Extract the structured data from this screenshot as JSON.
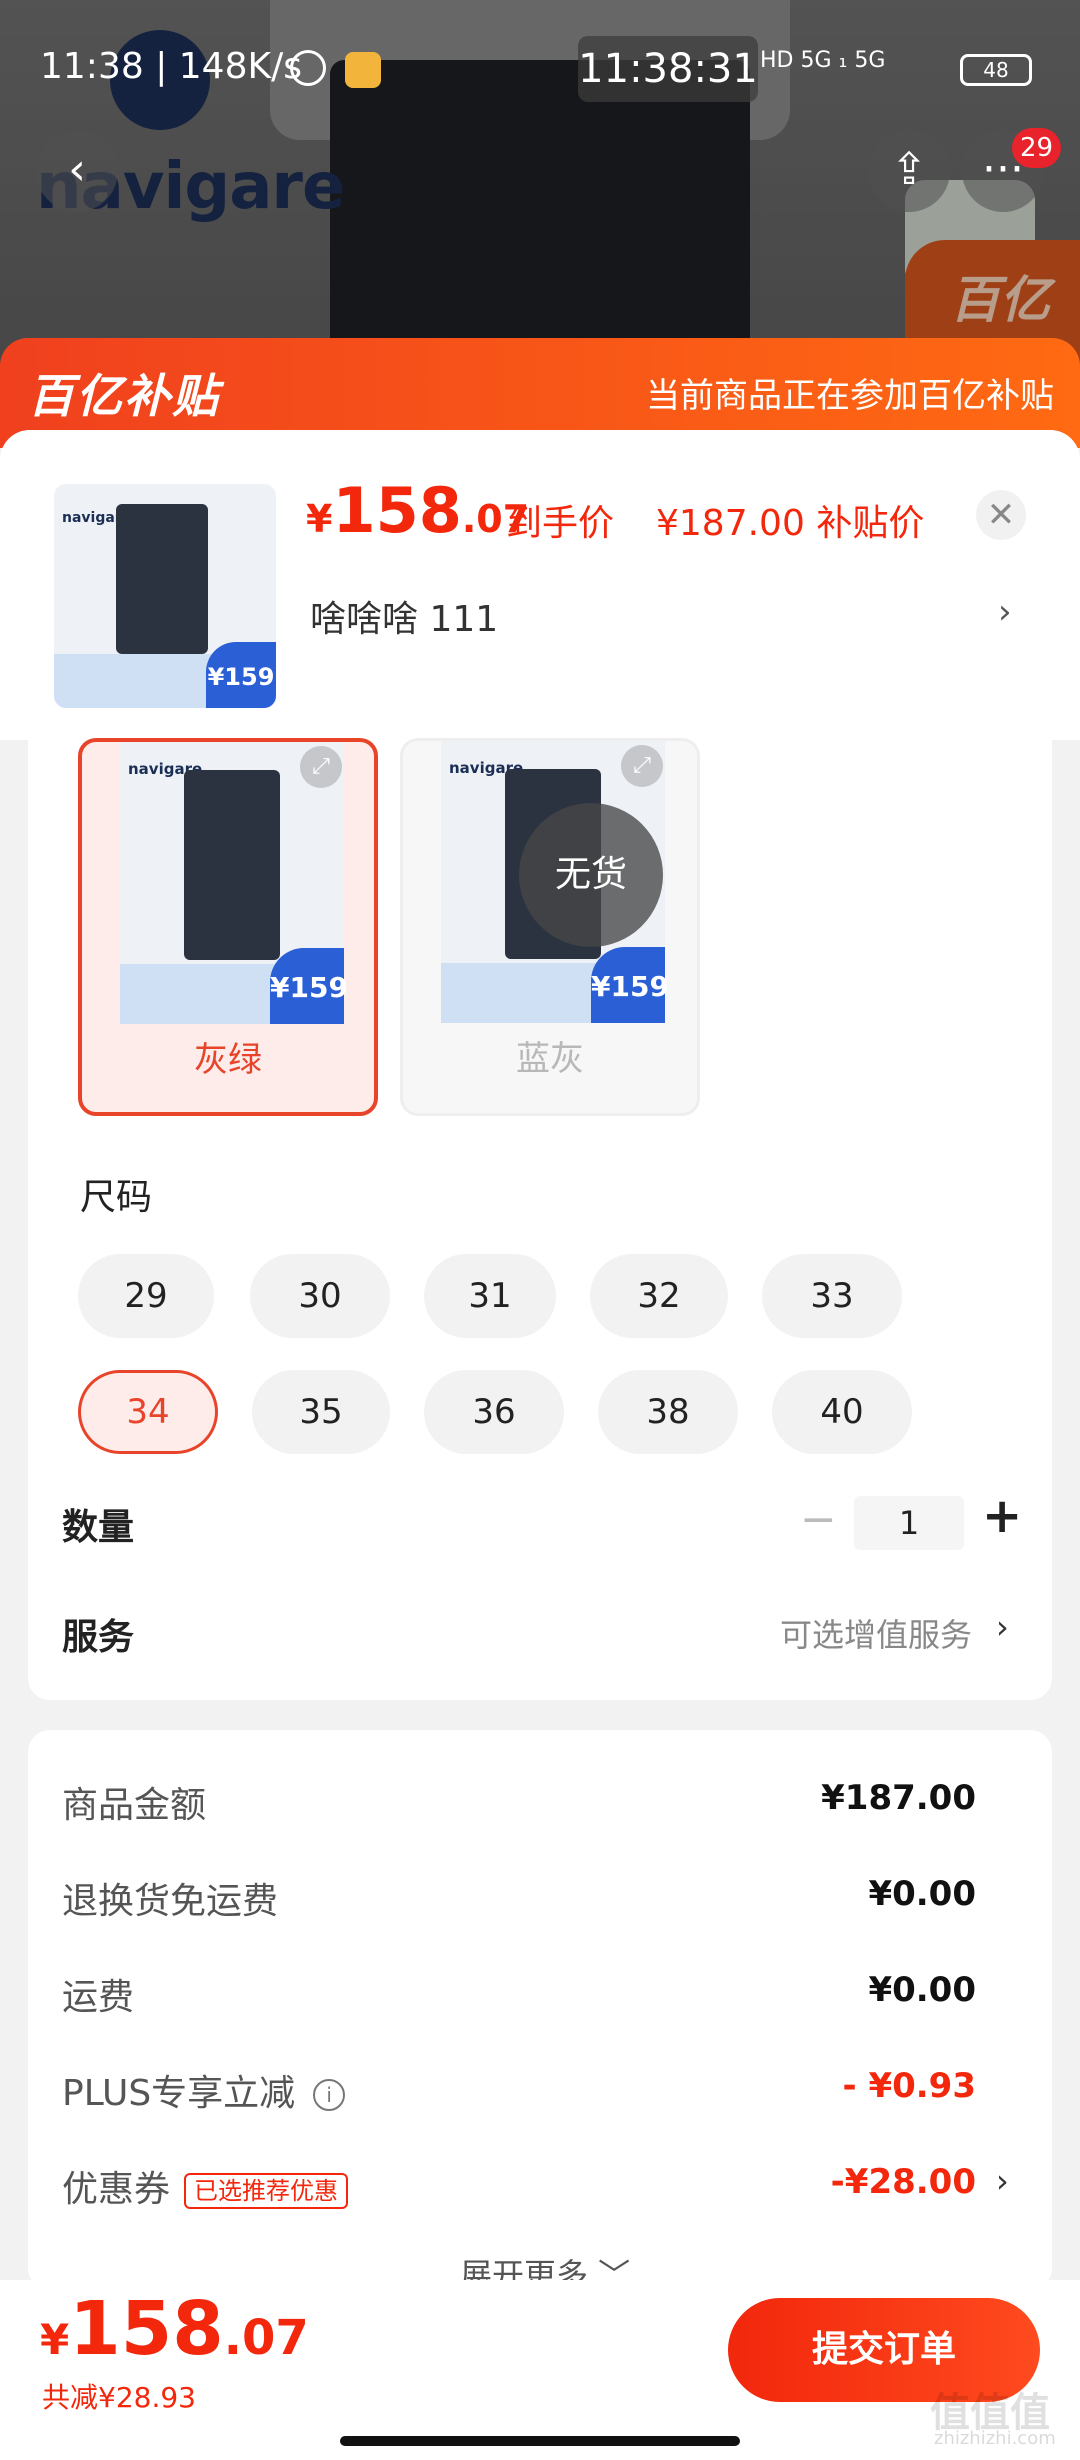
{
  "status_bar": {
    "time_left": "11:38 | 148K/s",
    "clock_overlay": "11:38:31",
    "network": "HD 5G ₁ 5G",
    "battery": "48"
  },
  "background": {
    "brand": "navigare",
    "badge_text": "百亿补"
  },
  "nav": {
    "back_icon": "‹",
    "share_icon": "⇪",
    "more_icon": "···",
    "message_count": "29"
  },
  "subsidy_bar": {
    "logo": "百亿补贴",
    "tip": "当前商品正在参加百亿补贴"
  },
  "sku_header": {
    "thumb_brand": "navigare",
    "thumb_price": "¥159",
    "price_yen": "¥",
    "price_int": "158",
    "price_dec": ".07",
    "price_label": "到手价",
    "subsidy_price": "¥187.00 补贴价",
    "close_icon": "✕",
    "selected_spec": "啥啥啥  111",
    "arrow": "›"
  },
  "colors": {
    "options": [
      {
        "label": "灰绿",
        "thumb_price": "¥159",
        "brand": "navigare",
        "selected": true
      },
      {
        "label": "蓝灰",
        "thumb_price": "¥159",
        "brand": "navigare",
        "soldout_text": "无货",
        "selected": false
      }
    ],
    "expand_icon": "⤢"
  },
  "sizes": {
    "title": "尺码",
    "options": [
      "29",
      "30",
      "31",
      "32",
      "33",
      "34",
      "35",
      "36",
      "38",
      "40"
    ],
    "selected": "34"
  },
  "quantity": {
    "label": "数量",
    "minus": "−",
    "value": "1",
    "plus": "+"
  },
  "service": {
    "label": "服务",
    "option": "可选增值服务",
    "arrow": "›"
  },
  "price_summary": {
    "rows": [
      {
        "label": "商品金额",
        "value": "¥187.00"
      },
      {
        "label": "退换货免运费",
        "value": "¥0.00"
      },
      {
        "label": "运费",
        "value": "¥0.00"
      },
      {
        "label": "PLUS专享立减",
        "value": "- ¥0.93",
        "info_icon": "i"
      },
      {
        "label": "优惠券",
        "value": "-¥28.00",
        "tag": "已选推荐优惠",
        "arrow": "›"
      }
    ],
    "expand_more": "展开更多 ﹀"
  },
  "bottom": {
    "price_yen": "¥",
    "price_int": "158",
    "price_dec": ".07",
    "savings": "共减¥28.93",
    "submit": "提交订单"
  },
  "watermark": {
    "text": "值值值",
    "sub": "zhizhizhi.com"
  },
  "accent_color": "#f2270c"
}
